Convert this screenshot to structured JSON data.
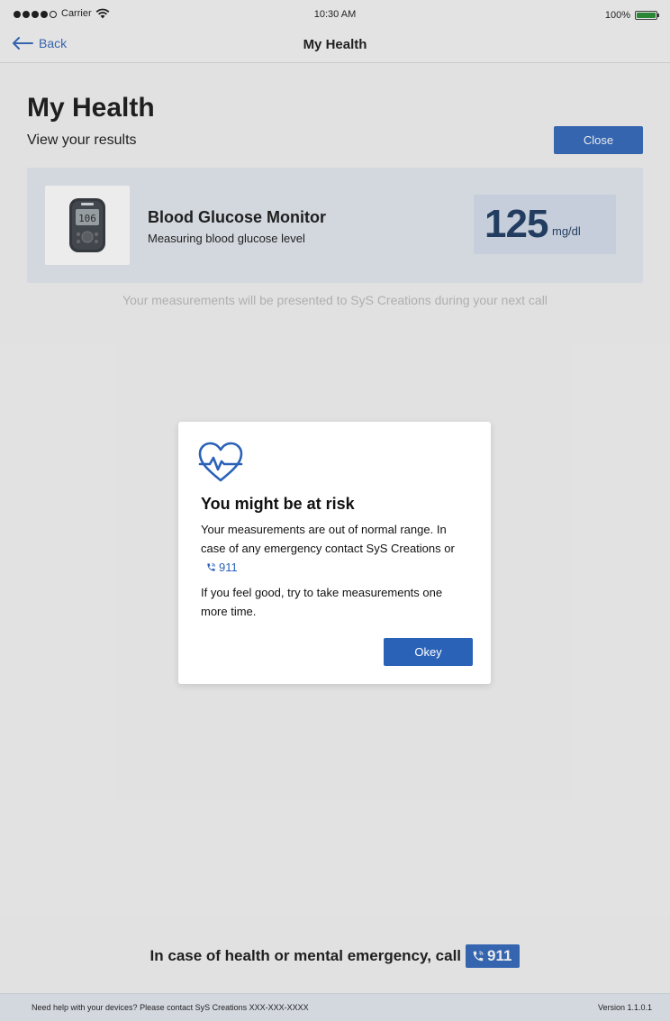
{
  "status_bar": {
    "carrier": "Carrier",
    "time": "10:30 AM",
    "battery": "100%",
    "signal_bars_filled": 4,
    "signal_bars_total": 5
  },
  "nav": {
    "back_label": "Back",
    "title": "My Health"
  },
  "page": {
    "title": "My Health",
    "subtitle": "View your results",
    "close_label": "Close"
  },
  "device_card": {
    "title": "Blood Glucose Monitor",
    "subtitle": "Measuring blood glucose level",
    "reading_value": "125",
    "reading_unit": "mg/dl",
    "device_display": "106",
    "image_icon": "glucose-meter"
  },
  "note": "Your measurements will be presented to SyS Creations during your next call",
  "modal": {
    "icon": "heart-pulse-icon",
    "title": "You might be at risk",
    "line1": "Your measurements are out of normal range. In case of any emergency contact SyS Creations or",
    "call_number": "911",
    "line2": "If you feel good, try to take measurements one more time.",
    "ok_label": "Okey"
  },
  "emergency": {
    "text": "In case of health or mental emergency, call",
    "number": "911"
  },
  "footer": {
    "help": "Need help with your devices? Please contact SyS Creations XXX-XXX-XXXX",
    "version": "Version 1.1.0.1"
  },
  "colors": {
    "accent": "#2a62b8",
    "card_bg": "#e2e8f0",
    "reading_bg": "#d2dcea",
    "reading_text": "#16345e",
    "battery": "#1e8a2a"
  }
}
